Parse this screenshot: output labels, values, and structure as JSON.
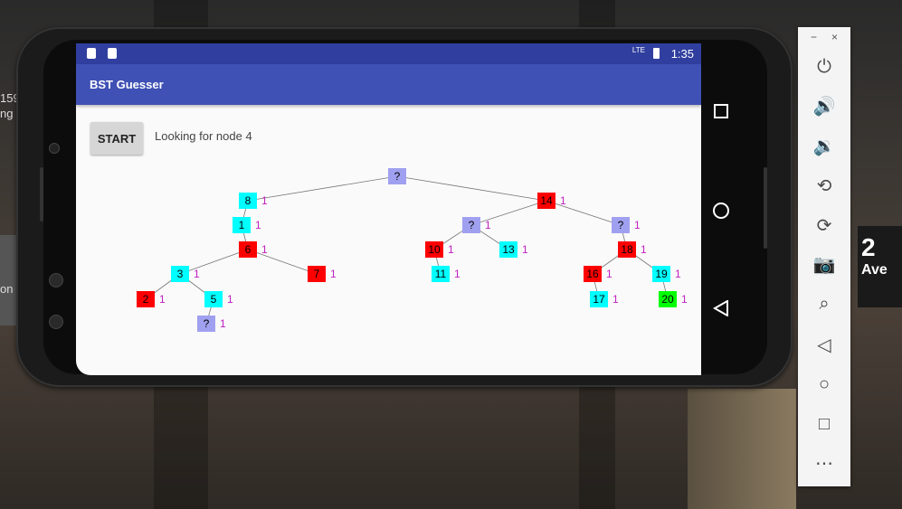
{
  "desktop": {
    "side_text": [
      "159",
      "ng",
      "on"
    ],
    "sign_text": "2",
    "sign_sub": "Ave"
  },
  "status_bar": {
    "time": "1:35",
    "network": "LTE"
  },
  "app": {
    "title": "BST Guesser",
    "start_label": "START",
    "status_message": "Looking for node 4"
  },
  "colors": {
    "red": "#ff0000",
    "cyan": "#00ffff",
    "lavender": "#a0a0f0",
    "green": "#00ff00",
    "count": "#c020c0",
    "primary": "#3f51b5",
    "primary_dark": "#303f9f"
  },
  "tree": {
    "nodes": [
      {
        "id": "root",
        "label": "?",
        "color": "#a0a0f0",
        "count": ""
      },
      {
        "id": "n8",
        "label": "8",
        "color": "#00ffff",
        "count": "1"
      },
      {
        "id": "n14",
        "label": "14",
        "color": "#ff0000",
        "count": "1"
      },
      {
        "id": "n1",
        "label": "1",
        "color": "#00ffff",
        "count": "1"
      },
      {
        "id": "n6",
        "label": "6",
        "color": "#ff0000",
        "count": "1"
      },
      {
        "id": "n3",
        "label": "3",
        "color": "#00ffff",
        "count": "1"
      },
      {
        "id": "n7",
        "label": "7",
        "color": "#ff0000",
        "count": "1"
      },
      {
        "id": "n2",
        "label": "2",
        "color": "#ff0000",
        "count": "1"
      },
      {
        "id": "n5",
        "label": "5",
        "color": "#00ffff",
        "count": "1"
      },
      {
        "id": "q4",
        "label": "?",
        "color": "#a0a0f0",
        "count": "1"
      },
      {
        "id": "ql",
        "label": "?",
        "color": "#a0a0f0",
        "count": "1"
      },
      {
        "id": "n10",
        "label": "10",
        "color": "#ff0000",
        "count": "1"
      },
      {
        "id": "n13",
        "label": "13",
        "color": "#00ffff",
        "count": "1"
      },
      {
        "id": "n11",
        "label": "11",
        "color": "#00ffff",
        "count": "1"
      },
      {
        "id": "qr",
        "label": "?",
        "color": "#a0a0f0",
        "count": "1"
      },
      {
        "id": "n18",
        "label": "18",
        "color": "#ff0000",
        "count": "1"
      },
      {
        "id": "n16",
        "label": "16",
        "color": "#ff0000",
        "count": "1"
      },
      {
        "id": "n19",
        "label": "19",
        "color": "#00ffff",
        "count": "1"
      },
      {
        "id": "n17",
        "label": "17",
        "color": "#00ffff",
        "count": "1"
      },
      {
        "id": "n20",
        "label": "20",
        "color": "#00ff00",
        "count": "1"
      }
    ],
    "edges": [
      [
        "root",
        "n8"
      ],
      [
        "root",
        "n14"
      ],
      [
        "n8",
        "n1"
      ],
      [
        "n1",
        "n6"
      ],
      [
        "n6",
        "n3"
      ],
      [
        "n6",
        "n7"
      ],
      [
        "n3",
        "n2"
      ],
      [
        "n3",
        "n5"
      ],
      [
        "n5",
        "q4"
      ],
      [
        "n14",
        "ql"
      ],
      [
        "n14",
        "qr"
      ],
      [
        "ql",
        "n10"
      ],
      [
        "ql",
        "n13"
      ],
      [
        "n10",
        "n11"
      ],
      [
        "qr",
        "n18"
      ],
      [
        "n18",
        "n16"
      ],
      [
        "n18",
        "n19"
      ],
      [
        "n16",
        "n17"
      ],
      [
        "n19",
        "n20"
      ]
    ]
  },
  "nav": {
    "recents_icon": "square-icon",
    "home_icon": "circle-icon",
    "back_icon": "triangle-back-icon"
  },
  "emulator_panel": {
    "minimize": "−",
    "close": "×",
    "buttons": [
      "power-icon",
      "volume-up-icon",
      "volume-down-icon",
      "rotate-left-icon",
      "rotate-right-icon",
      "camera-icon",
      "zoom-icon",
      "back-icon",
      "home-icon",
      "overview-icon",
      "more-icon"
    ]
  }
}
